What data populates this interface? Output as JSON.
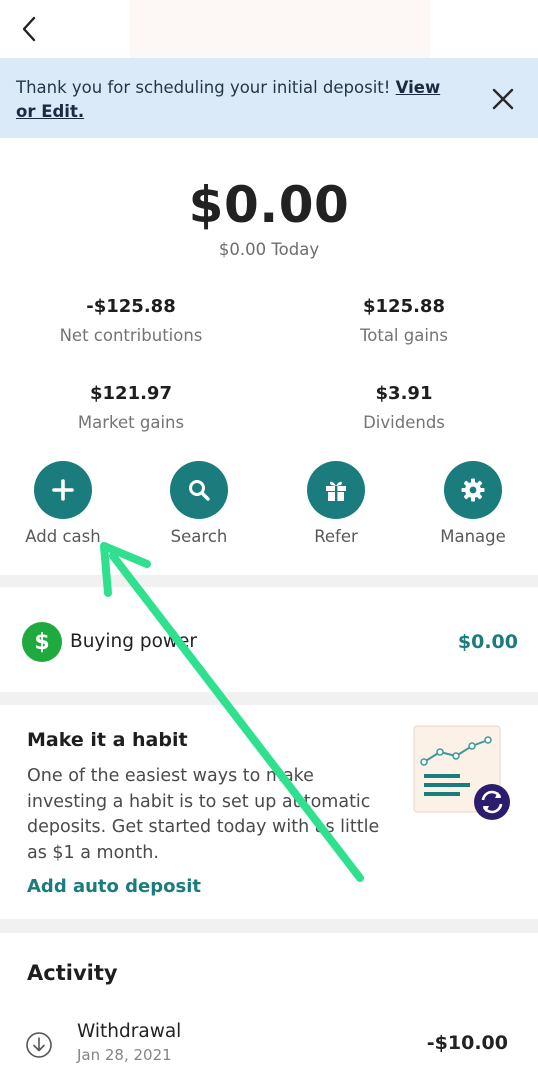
{
  "banner": {
    "text": "Thank you for scheduling your initial deposit! ",
    "link": "View or Edit."
  },
  "balance": {
    "amount": "$0.00",
    "today": "$0.00 Today"
  },
  "stats": [
    {
      "value": "-$125.88",
      "label": "Net contributions"
    },
    {
      "value": "$125.88",
      "label": "Total gains"
    },
    {
      "value": "$121.97",
      "label": "Market gains"
    },
    {
      "value": "$3.91",
      "label": "Dividends"
    }
  ],
  "actions": [
    {
      "label": "Add cash",
      "icon": "plus-icon"
    },
    {
      "label": "Search",
      "icon": "search-icon"
    },
    {
      "label": "Refer",
      "icon": "gift-icon"
    },
    {
      "label": "Manage",
      "icon": "gear-icon"
    }
  ],
  "buying_power": {
    "icon": "dollar-icon",
    "label": "Buying power",
    "value": "$0.00"
  },
  "habit": {
    "title": "Make it a habit",
    "body": "One of the easiest ways to make investing a habit is to set up automatic deposits. Get started today with as little as $1 a month.",
    "link": "Add auto deposit"
  },
  "activity": {
    "title": "Activity",
    "items": [
      {
        "name": "Withdrawal",
        "date": "Jan 28, 2021",
        "amount": "-$10.00",
        "icon": "download-circle-icon"
      }
    ]
  },
  "colors": {
    "accent": "#1b7c7d",
    "banner_bg": "#dbeaf8",
    "buying_power_icon": "#1faa3f",
    "annotation_arrow": "#2fe08f"
  }
}
